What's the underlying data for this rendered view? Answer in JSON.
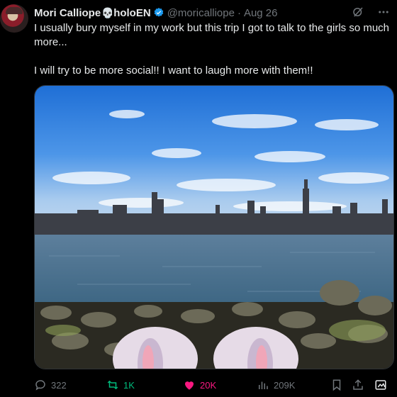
{
  "tweet": {
    "author_name": "Mori Calliope",
    "author_suffix": "holoEN",
    "handle": "@moricalliope",
    "separator": "·",
    "date": "Aug 26",
    "text_line1": "I usually bury myself in my work but this trip I got to talk to the girls so much more...",
    "text_line2": "I will try to be more social!! I want to laugh more with them!!"
  },
  "actions": {
    "replies": "322",
    "retweets": "1K",
    "likes": "20K",
    "views": "209K"
  },
  "colors": {
    "accent_like": "#f91880",
    "accent_retweet": "#00ba7c",
    "verified": "#1d9bf0",
    "muted": "#71767b"
  }
}
